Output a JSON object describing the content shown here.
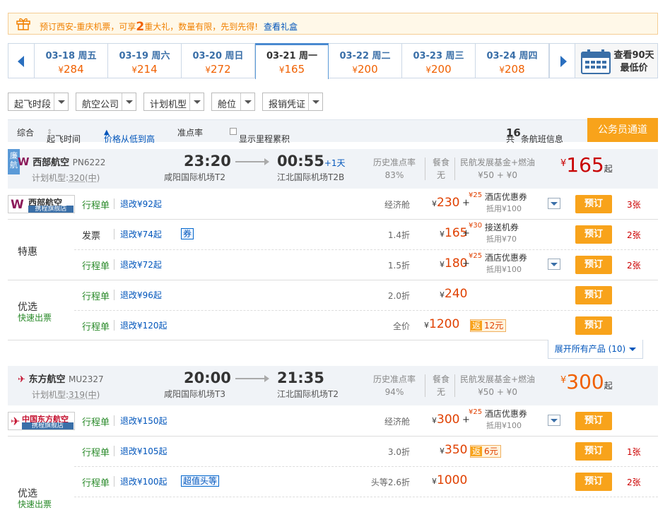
{
  "promo": {
    "text_before": "预订西安-重庆机票，可享",
    "count": "2",
    "text_after": "重大礼，数量有限，先到先得!",
    "link": "查看礼盒"
  },
  "dates": [
    {
      "date": "03-18",
      "weekday": "周五",
      "price": "284"
    },
    {
      "date": "03-19",
      "weekday": "周六",
      "price": "214"
    },
    {
      "date": "03-20",
      "weekday": "周日",
      "price": "272"
    },
    {
      "date": "03-21",
      "weekday": "周一",
      "price": "165"
    },
    {
      "date": "03-22",
      "weekday": "周二",
      "price": "200"
    },
    {
      "date": "03-23",
      "weekday": "周三",
      "price": "200"
    },
    {
      "date": "03-24",
      "weekday": "周四",
      "price": "208"
    }
  ],
  "selected_date_index": 3,
  "calendar90": {
    "line1": "查看90天",
    "line2": "最低价"
  },
  "filters": [
    "起飞时段",
    "航空公司",
    "计划机型",
    "舱位",
    "报销凭证"
  ],
  "sortbar": {
    "overall": "综合",
    "dep_time": "起飞时间",
    "price_asc": "价格从低到高",
    "ontime": "准点率",
    "mileage": "显示里程累积",
    "total_prefix": "共",
    "total_count": "16",
    "total_suffix": "条航班信息",
    "official_btn": "公务员通道"
  },
  "currency": "¥",
  "labels": {
    "ontime": "历史准点率",
    "meal": "餐食",
    "fund": "民航发展基金+燃油",
    "from": "起",
    "book": "预订",
    "itinerary": "行程单",
    "invoice": "发票",
    "te_hui": "特惠",
    "you_xuan": "优选",
    "fast_ticket": "快速出票",
    "lian_hang": "廉航",
    "expand_all": "展开所有产品 (10)",
    "plan_model_prefix": "计划机型:"
  },
  "flights": [
    {
      "airline": "西部航空",
      "flight_no": "PN6222",
      "model": "320(中)",
      "dep_time": "23:20",
      "dep_airport": "咸阳国际机场T2",
      "arr_time": "00:55",
      "next_day": "+1天",
      "arr_airport": "江北国际机场T2B",
      "ontime_rate": "83%",
      "meal": "无",
      "fund": "¥50 + ¥0",
      "price": "165",
      "logo_name": "西部航空",
      "logo_sub": "携程旗舰店",
      "color": "#8b1a5a"
    },
    {
      "airline": "东方航空",
      "flight_no": "MU2327",
      "model": "319(中)",
      "dep_time": "20:00",
      "dep_airport": "咸阳国际机场T3",
      "arr_time": "21:35",
      "next_day": "",
      "arr_airport": "江北国际机场T2",
      "ontime_rate": "94%",
      "meal": "无",
      "fund": "¥50 + ¥0",
      "price": "300",
      "logo_name": "中国东方航空",
      "logo_sub": "携程旗舰店",
      "color": "#c41230"
    }
  ],
  "f1_rows": [
    {
      "doc": "行程单",
      "refund": "退改¥92起",
      "cabin": "经济舱",
      "price": "230",
      "coupon_amt": "¥25",
      "coupon_name": "酒店优惠券",
      "coupon_sub": "抵用¥100",
      "left": "3张"
    },
    {
      "doc": "发票",
      "refund": "退改¥74起",
      "chip": "券",
      "cabin": "1.4折",
      "price": "165",
      "coupon_amt": "¥30",
      "coupon_name": "接送机券",
      "coupon_sub": "抵用¥70",
      "left": "2张"
    },
    {
      "doc": "行程单",
      "refund": "退改¥72起",
      "cabin": "1.5折",
      "price": "180",
      "coupon_amt": "¥25",
      "coupon_name": "酒店优惠券",
      "coupon_sub": "抵用¥100",
      "left": "2张"
    },
    {
      "doc": "行程单",
      "refund": "退改¥96起",
      "cabin": "2.0折",
      "price": "240"
    },
    {
      "doc": "行程单",
      "refund": "退改¥120起",
      "cabin": "全价",
      "price": "1200",
      "fan1": "返",
      "fan2": "12元"
    }
  ],
  "f2_rows": [
    {
      "doc": "行程单",
      "refund": "退改¥150起",
      "cabin": "经济舱",
      "price": "300",
      "coupon_amt": "¥25",
      "coupon_name": "酒店优惠券",
      "coupon_sub": "抵用¥100"
    },
    {
      "doc": "行程单",
      "refund": "退改¥105起",
      "cabin": "3.0折",
      "price": "350",
      "fan1": "返",
      "fan2": "6元",
      "left": "1张"
    },
    {
      "doc": "行程单",
      "refund": "退改¥100起",
      "chip": "超值头等",
      "cabin": "头等2.6折",
      "price": "1000",
      "left": "2张"
    }
  ]
}
